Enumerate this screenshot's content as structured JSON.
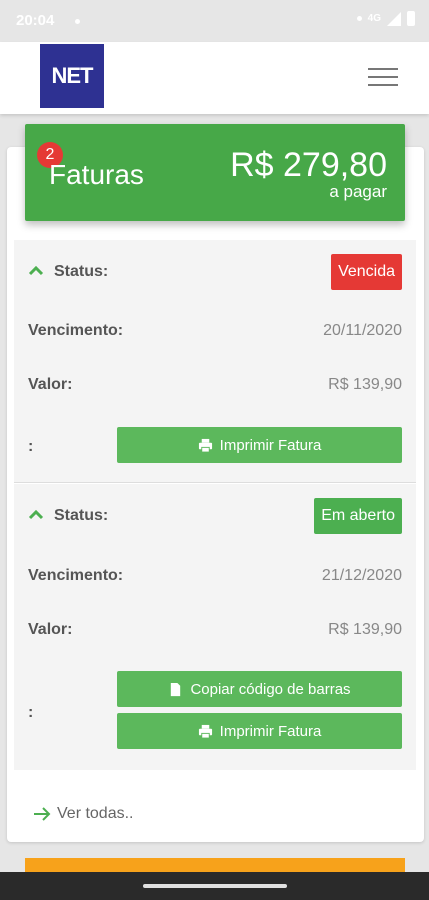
{
  "status_bar": {
    "time": "20:04",
    "network": "4G"
  },
  "app": {
    "logo_text": "NET"
  },
  "summary": {
    "badge_count": "2",
    "title": "Faturas",
    "amount": "R$ 279,80",
    "amount_caption": "a pagar"
  },
  "invoices": [
    {
      "status_label": "Status:",
      "status_value": "Vencida",
      "due_label": "Vencimento:",
      "due_value": "20/11/2020",
      "value_label": "Valor:",
      "value_value": "R$ 139,90",
      "actions_label": ":",
      "print_label": "Imprimir Fatura"
    },
    {
      "status_label": "Status:",
      "status_value": "Em aberto",
      "due_label": "Vencimento:",
      "due_value": "21/12/2020",
      "value_label": "Valor:",
      "value_value": "R$ 139,90",
      "actions_label": ":",
      "copy_label": "Copiar código de barras",
      "print_label": "Imprimir Fatura"
    }
  ],
  "footer": {
    "see_all": "Ver todas.."
  },
  "colors": {
    "green": "#47a848",
    "red": "#e53935",
    "brand_blue": "#2e3192",
    "orange": "#f7a21b"
  }
}
